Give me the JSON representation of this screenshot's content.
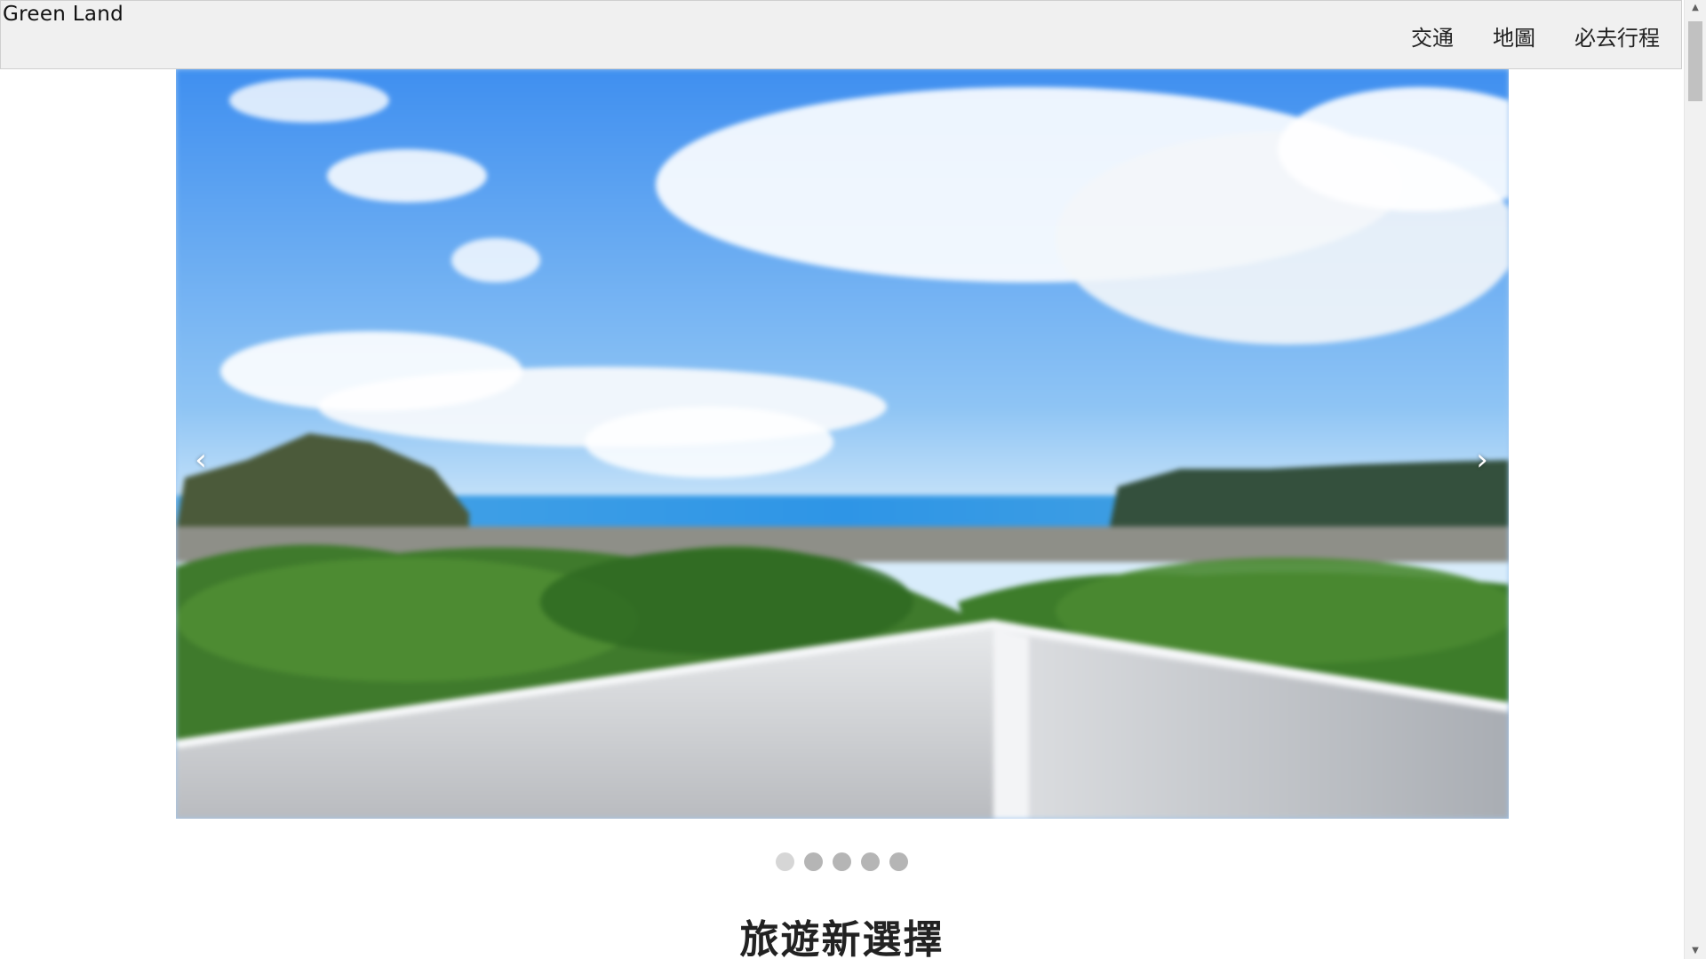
{
  "navbar": {
    "brand": "Green Land",
    "links": [
      {
        "label": "交通"
      },
      {
        "label": "地圖"
      },
      {
        "label": "必去行程"
      }
    ]
  },
  "carousel": {
    "prev_glyph": "‹",
    "next_glyph": "›",
    "slide_count": 5,
    "active_index": 0
  },
  "section": {
    "title": "旅遊新選擇"
  },
  "colors": {
    "navbar_bg": "#f0f0f0",
    "dot": "#b5b5b5",
    "dot_active": "#d6d6d6"
  },
  "icons": {
    "prev": "chevron-left-icon",
    "next": "chevron-right-icon"
  }
}
